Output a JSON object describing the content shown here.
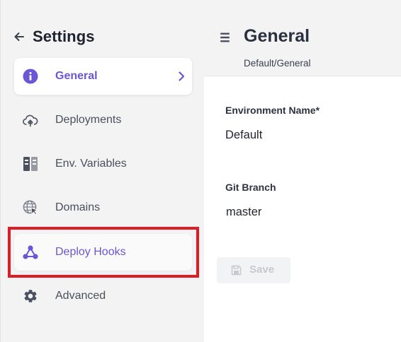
{
  "sidebar": {
    "title": "Settings",
    "back_icon": "arrow-left-icon",
    "items": [
      {
        "label": "General",
        "icon": "info-circle-icon",
        "state": "active"
      },
      {
        "label": "Deployments",
        "icon": "cloud-upload-icon",
        "state": "normal"
      },
      {
        "label": "Env. Variables",
        "icon": "variables-columns-icon",
        "state": "normal"
      },
      {
        "label": "Domains",
        "icon": "globe-cursor-icon",
        "state": "normal"
      },
      {
        "label": "Deploy Hooks",
        "icon": "webhook-icon",
        "state": "hovered"
      },
      {
        "label": "Advanced",
        "icon": "gear-icon",
        "state": "normal"
      }
    ]
  },
  "header": {
    "menu_icon": "hamburger-menu-icon",
    "title": "General",
    "breadcrumb": "Default/General"
  },
  "form": {
    "environment_name": {
      "label": "Environment Name*",
      "value": "Default"
    },
    "git_branch": {
      "label": "Git Branch",
      "value": "master"
    },
    "save_button": {
      "label": "Save",
      "icon": "floppy-disk-icon",
      "state": "disabled"
    }
  },
  "colors": {
    "accent": "#6b56d4",
    "sidebar_bg": "#f3f3f4",
    "highlight": "#e01b24",
    "icon": "#4b5160"
  }
}
